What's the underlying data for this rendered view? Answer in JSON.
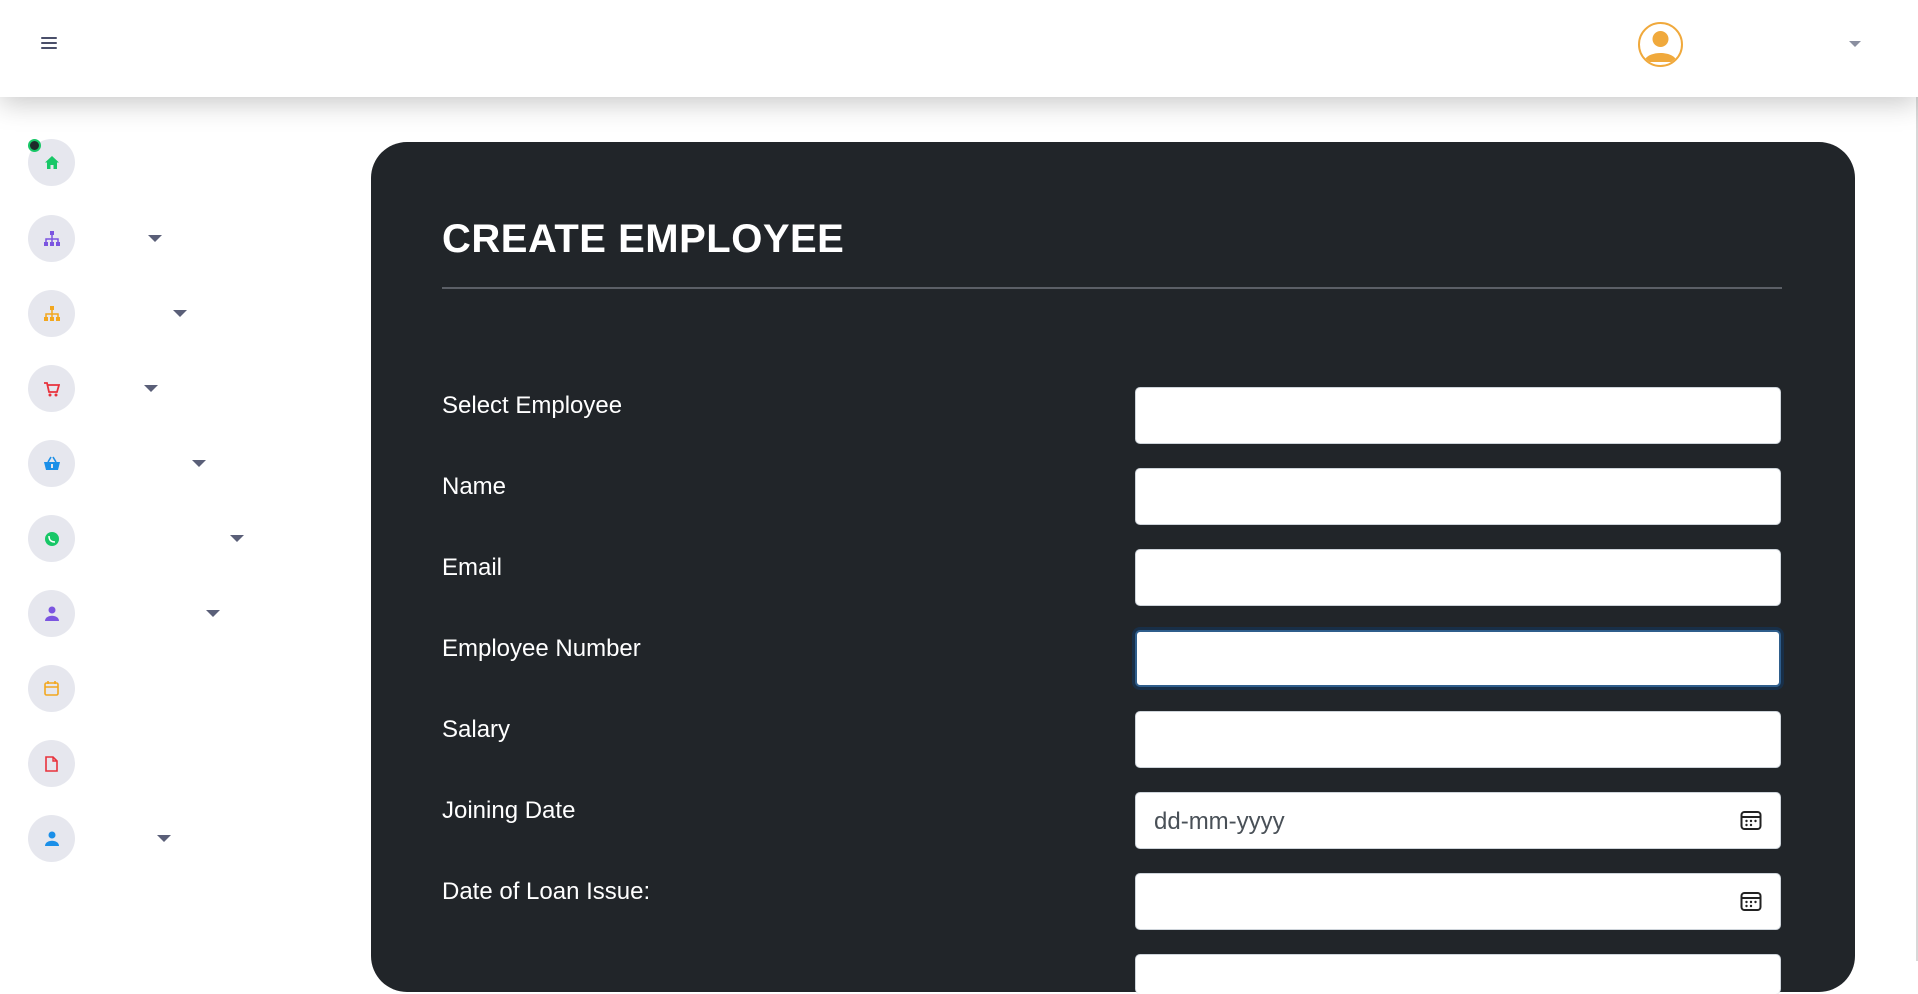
{
  "header": {
    "menu_icon": "hamburger-icon",
    "avatar_icon": "user-avatar-icon",
    "dropdown_icon": "caret-down-icon"
  },
  "sidebar": {
    "items": [
      {
        "icon": "home-icon",
        "color": "#18c767",
        "has_caret": false
      },
      {
        "icon": "sitemap-icon",
        "color": "#7b55e0",
        "has_caret": true
      },
      {
        "icon": "sitemap-icon",
        "color": "#f2a71f",
        "has_caret": true
      },
      {
        "icon": "cart-icon",
        "color": "#e8323c",
        "has_caret": true
      },
      {
        "icon": "basket-icon",
        "color": "#1a8fe8",
        "has_caret": true
      },
      {
        "icon": "whatsapp-icon",
        "color": "#18c767",
        "has_caret": true
      },
      {
        "icon": "user-icon",
        "color": "#7b55e0",
        "has_caret": true
      },
      {
        "icon": "calendar-icon",
        "color": "#f2a71f",
        "has_caret": false
      },
      {
        "icon": "file-icon",
        "color": "#e8323c",
        "has_caret": false
      },
      {
        "icon": "user-icon",
        "color": "#1a8fe8",
        "has_caret": true
      }
    ]
  },
  "form": {
    "title": "CREATE EMPLOYEE",
    "fields": [
      {
        "label": "Select Employee",
        "value": ""
      },
      {
        "label": "Name",
        "value": ""
      },
      {
        "label": "Email",
        "value": ""
      },
      {
        "label": "Employee Number",
        "value": ""
      },
      {
        "label": "Salary",
        "value": ""
      },
      {
        "label": "Joining Date",
        "placeholder": "dd-mm-yyyy"
      },
      {
        "label": "Date of Loan Issue:",
        "placeholder": ""
      }
    ]
  },
  "colors": {
    "card_bg": "#212529",
    "accent_avatar": "#f0a93c",
    "focus_ring": "#2f5e8c"
  }
}
